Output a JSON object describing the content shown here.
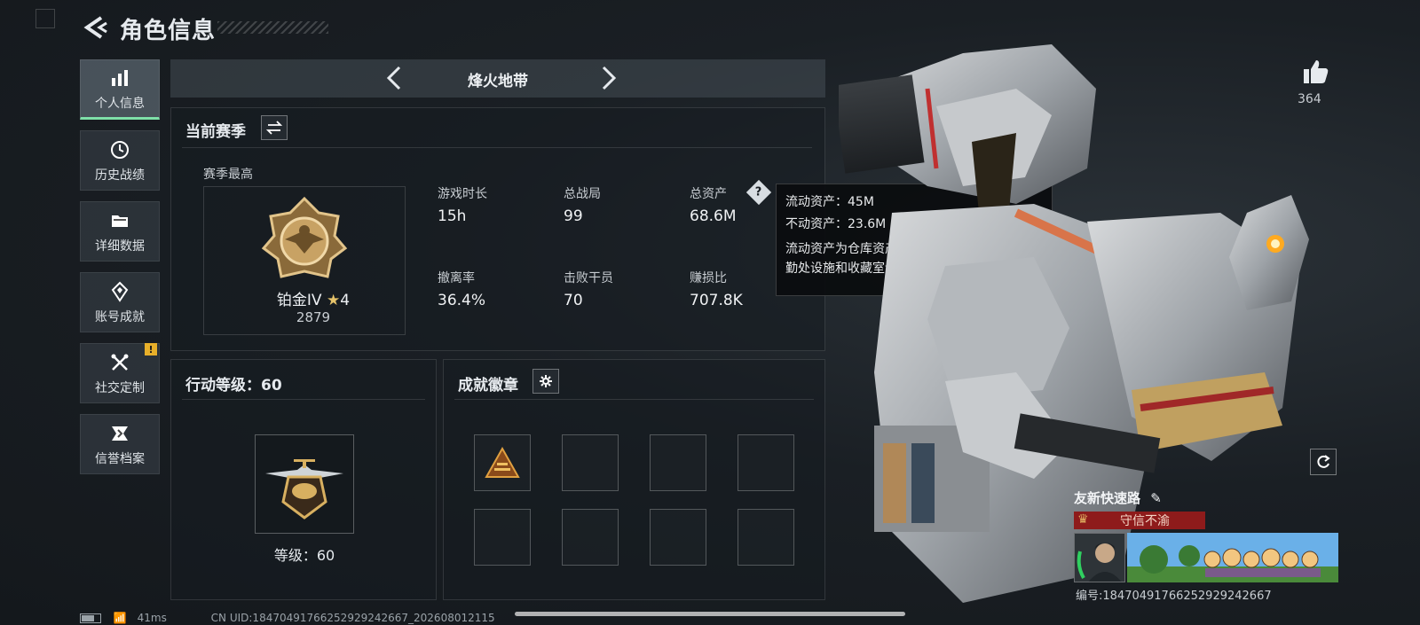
{
  "header": {
    "title": "角色信息"
  },
  "sidebar": {
    "items": [
      {
        "label": "个人信息",
        "icon": "bar-chart-icon",
        "active": true
      },
      {
        "label": "历史战绩",
        "icon": "clock-icon",
        "active": false
      },
      {
        "label": "详细数据",
        "icon": "folder-icon",
        "active": false
      },
      {
        "label": "账号成就",
        "icon": "achievement-icon",
        "active": false
      },
      {
        "label": "社交定制",
        "icon": "tools-icon",
        "active": false,
        "badge": "!"
      },
      {
        "label": "信誉档案",
        "icon": "credit-shield-icon",
        "active": false
      }
    ]
  },
  "mode": {
    "title": "烽火地带"
  },
  "season": {
    "title": "当前赛季",
    "best_label": "赛季最高",
    "rank_name": "铂金IV",
    "rank_stars": "4",
    "rank_points": "2879",
    "stats": [
      {
        "label": "游戏时长",
        "value": "15h"
      },
      {
        "label": "总战局",
        "value": "99"
      },
      {
        "label": "总资产",
        "value": "68.6M"
      },
      {
        "label": "撤离率",
        "value": "36.4%"
      },
      {
        "label": "击败干员",
        "value": "70"
      },
      {
        "label": "赚损比",
        "value": "707.8K"
      }
    ]
  },
  "tooltip": {
    "line1": "流动资产：45M",
    "line2": "不动资产：23.6M",
    "desc": "流动资产为仓库资产和哈夫币，不动资产为特勤处设施和收藏室设施"
  },
  "action_level": {
    "title": "行动等级：60",
    "level_text": "等级：60"
  },
  "badges": {
    "title": "成就徽章"
  },
  "profile": {
    "likes": "364",
    "name": "友新快速路",
    "honor": "守信不渝",
    "uid_tag": "编号:18470491766252929242667"
  },
  "statusbar": {
    "ping": "41ms",
    "uid": "CN UID:18470491766252929242667_202608012115"
  },
  "colors": {
    "accent": "#7fe0a8",
    "honor_bg": "#8e1b1b",
    "warning": "#e8b02a"
  }
}
